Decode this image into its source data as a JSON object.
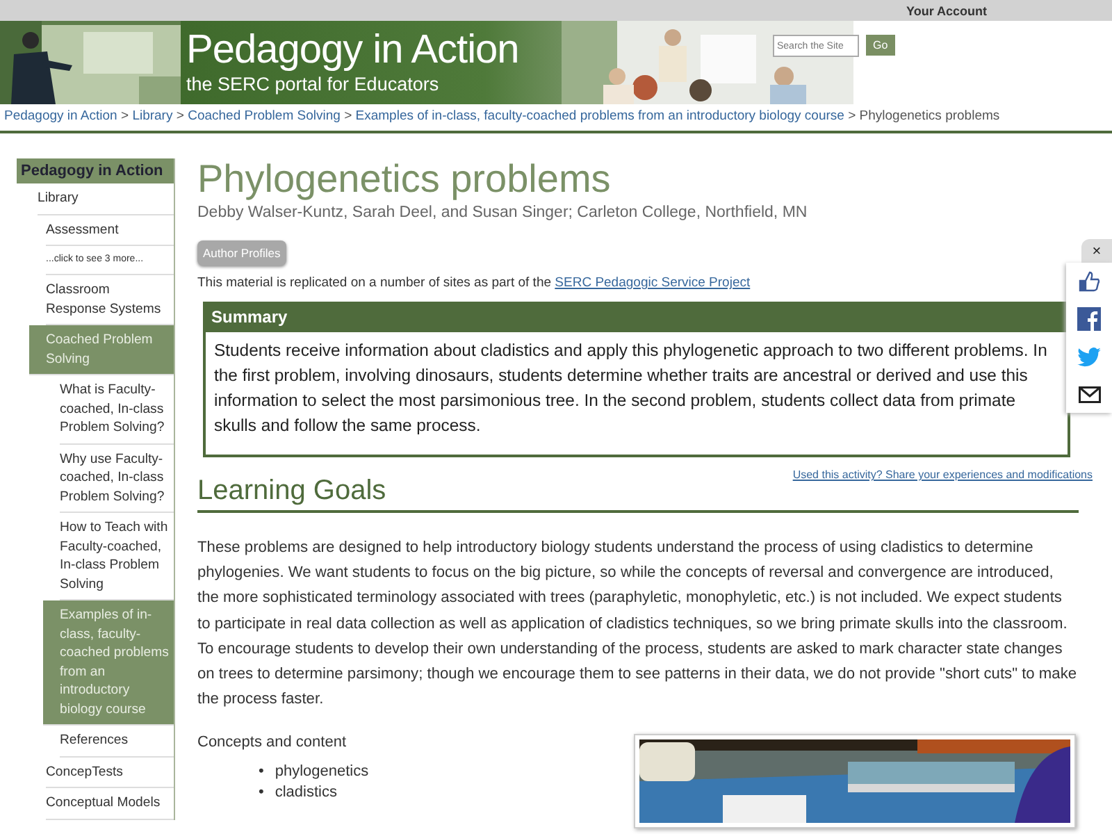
{
  "top_bar": {
    "account_link": "Your Account"
  },
  "banner": {
    "title": "Pedagogy in Action",
    "subtitle": "the SERC portal for Educators",
    "search": {
      "placeholder": "Search the Site",
      "button": "Go"
    }
  },
  "breadcrumb_separator": ">",
  "bullet": "•",
  "breadcrumbs": [
    {
      "label": "Pedagogy in Action",
      "link": true
    },
    {
      "label": "Library",
      "link": true
    },
    {
      "label": "Coached Problem Solving",
      "link": true
    },
    {
      "label": "Examples of in-class, faculty-coached problems from an introductory biology course",
      "link": true
    },
    {
      "label": "Phylogenetics problems",
      "link": false
    }
  ],
  "sidebar": {
    "title": "Pedagogy in Action",
    "items": [
      {
        "label": "Library",
        "selected": false,
        "children": [
          {
            "label": "Assessment",
            "selected": false
          },
          {
            "label": "...click to see 3 more...",
            "selected": false,
            "kind": "more"
          },
          {
            "label": "Classroom Response Systems",
            "selected": false
          },
          {
            "label": "Coached Problem Solving",
            "selected": true,
            "children": [
              {
                "label": "What is Faculty-coached, In-class Problem Solving?",
                "selected": false
              },
              {
                "label": "Why use Faculty-coached, In-class Problem Solving?",
                "selected": false
              },
              {
                "label": "How to Teach with Faculty-coached, In-class Problem Solving",
                "selected": false
              },
              {
                "label": "Examples of in-class, faculty-coached problems from an introductory biology course",
                "selected": true
              },
              {
                "label": "References",
                "selected": false
              }
            ]
          },
          {
            "label": "ConcepTests",
            "selected": false
          },
          {
            "label": "Conceptual Models",
            "selected": false
          }
        ]
      }
    ]
  },
  "page": {
    "title": "Phylogenetics problems",
    "authors": "Debby Walser-Kuntz, Sarah Deel, and Susan Singer; Carleton College, Northfield, MN",
    "author_profiles_button": "Author Profiles",
    "replication_note": "This material is replicated on a number of sites as part of the",
    "replication_link": "SERC Pedagogic Service Project",
    "summary": {
      "heading": "Summary",
      "text": "Students receive information about cladistics and apply this phylogenetic approach to two different problems. In the first problem, involving dinosaurs, students determine whether traits are ancestral or derived and use this information to select the most parsimonious tree. In the second problem, students collect data from primate skulls and follow the same process."
    },
    "share_link": "Used this activity? Share your experiences and modifications",
    "learning_goals": {
      "heading": "Learning Goals",
      "text": "These problems are designed to help introductory biology students understand the process of using cladistics to determine phylogenies. We want students to focus on the big picture, so while the concepts of reversal and convergence are introduced, the more sophisticated terminology associated with trees (paraphyletic, monophyletic, etc.) is not included. We expect students to participate in real data collection as well as application of cladistics techniques, so we bring primate skulls into the classroom. To encourage students to develop their own understanding of the process, students are asked to mark character state changes on trees to determine parsimony; though we encourage them to see patterns in their data, we do not provide \"short cuts\" to make the process faster.",
      "concepts_heading": "Concepts and content",
      "concepts": [
        "phylogenetics",
        "cladistics"
      ]
    }
  },
  "share_panel": {
    "close": "×",
    "buttons": [
      {
        "kind": "like"
      },
      {
        "kind": "facebook"
      },
      {
        "kind": "twitter"
      },
      {
        "kind": "email"
      }
    ]
  }
}
